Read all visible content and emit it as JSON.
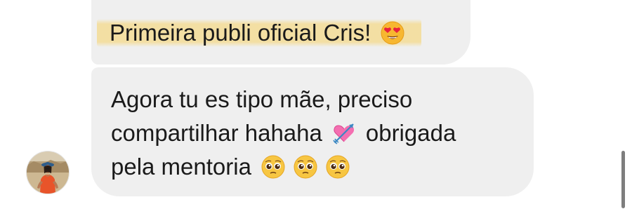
{
  "conversation": {
    "messages": [
      {
        "lines": [
          {
            "text": "Primeira publi oficial Cris!",
            "emoji_after": "heart-eyes-emoji"
          }
        ]
      },
      {
        "lines": [
          {
            "text": "Agora tu es tipo mãe, preciso"
          },
          {
            "text_before": "compartilhar hahaha",
            "emoji": "heart-with-arrow-emoji",
            "text_after": "obrigada"
          },
          {
            "text": "pela mentoria",
            "emojis": [
              "pleading-face-emoji",
              "pleading-face-emoji",
              "pleading-face-emoji"
            ]
          }
        ]
      }
    ],
    "sender_avatar": "profile-avatar"
  },
  "colors": {
    "bubble": "#efefef",
    "text": "#1a1a1a",
    "highlight": "#f4dc96",
    "scrollbar": "#7e7e7e"
  }
}
